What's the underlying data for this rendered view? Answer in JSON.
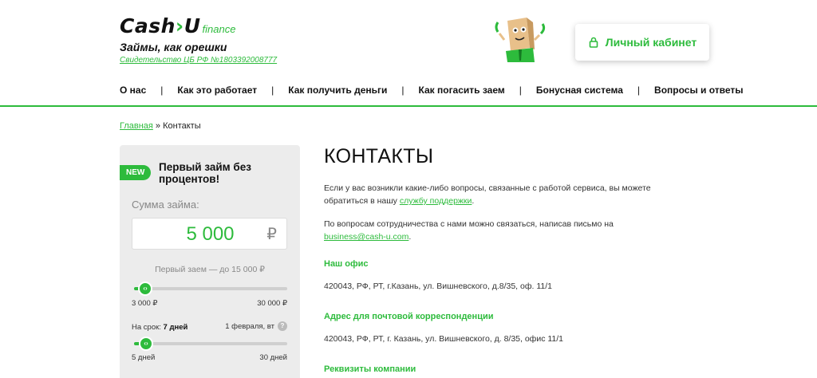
{
  "header": {
    "logo_cash": "Cash",
    "logo_arrow": "›",
    "logo_u": "U",
    "logo_sub": "finance",
    "tagline": "Займы, как орешки",
    "license": "Свидетельство ЦБ РФ №1803392008777",
    "cabinet_button": "Личный кабинет"
  },
  "nav": {
    "items": [
      "О нас",
      "Как это работает",
      "Как получить деньги",
      "Как погасить заем",
      "Бонусная система",
      "Вопросы и ответы"
    ],
    "separator": "|"
  },
  "breadcrumb": {
    "home": "Главная",
    "sep": " » ",
    "current": "Контакты"
  },
  "calculator": {
    "badge": "NEW",
    "title": "Первый займ без процентов!",
    "sum_label": "Сумма займа:",
    "amount": "5 000",
    "currency": "₽",
    "first_loan_note": "Первый заем — до 15 000 ₽",
    "amount_slider": {
      "min_label": "3 000 ₽",
      "max_label": "30 000 ₽",
      "level": 0.074
    },
    "term_prefix": "На срок: ",
    "term_value": "7 дней",
    "term_date": "1 февраля, вт",
    "help": "?",
    "term_slider": {
      "min_label": "5 дней",
      "max_label": "30 дней",
      "level": 0.08
    },
    "knob_glyph": "‹›"
  },
  "main": {
    "title": "КОНТАКТЫ",
    "intro_text": "Если у вас возникли какие-либо вопросы, связанные с работой сервиса, вы можете обратиться в нашу ",
    "intro_link": "службу поддержки",
    "intro_end": ".",
    "coop_text": "По вопросам сотрудничества с нами можно связаться, написав письмо на ",
    "coop_email": "business@cash-u.com",
    "coop_end": ".",
    "office_head": "Наш офис",
    "office_text": "420043, РФ, РТ, г.Казань, ул. Вишневского, д.8/35, оф. 11/1",
    "mail_head": "Адрес для почтовой корреспонденции",
    "mail_text": "420043, РФ, РТ, г. Казань, ул. Вишневского, д. 8/35, офис 11/1",
    "requisites_head": "Реквизиты компании"
  },
  "colors": {
    "accent": "#2dbb3c",
    "panel": "#ececec"
  }
}
